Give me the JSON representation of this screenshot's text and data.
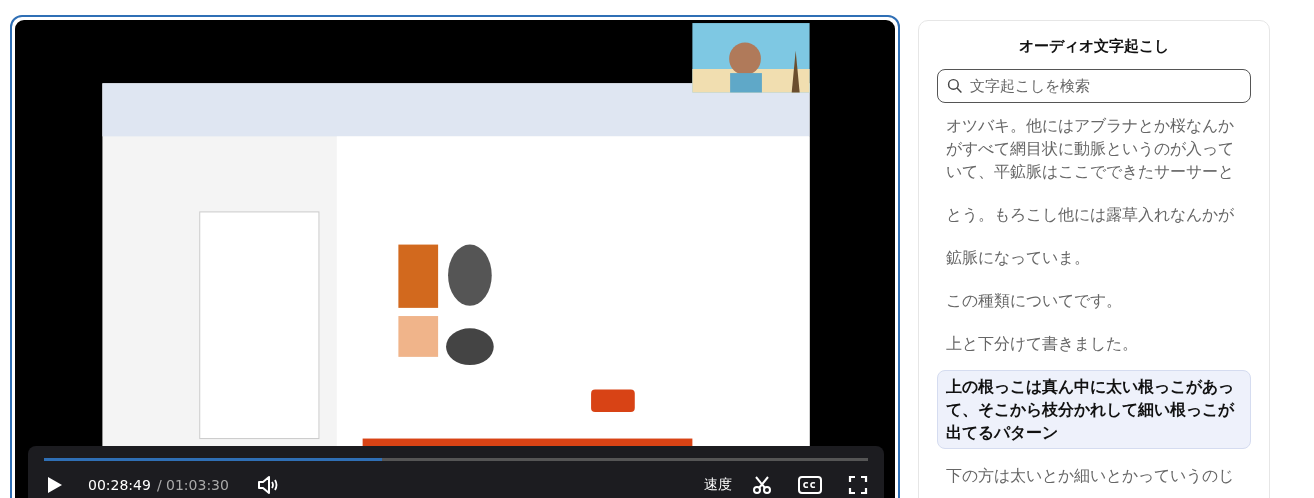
{
  "player": {
    "progress": {
      "level": 0.41
    },
    "time_current": "00:28:49",
    "time_total": "/ 01:03:30",
    "speed_label": "速度"
  },
  "transcript": {
    "title": "オーディオ文字起こし",
    "search": {
      "placeholder": "文字起こしを検索"
    },
    "items": [
      {
        "text": "オツバキ。他にはアブラナとか桜なんかがすべて網目状に動脈というのが入っていて、平鉱脈はここでできたサーサーと",
        "selected": false
      },
      {
        "text": "とう。もろこし他には露草入れなんかが",
        "selected": false
      },
      {
        "text": "鉱脈になっていま。",
        "selected": false
      },
      {
        "text": "この種類についてです。",
        "selected": false
      },
      {
        "text": "上と下分けて書きました。",
        "selected": false
      },
      {
        "text": "上の根っこは真ん中に太い根っこがあって、そこから枝分かれして細い根っこが出てるパターン",
        "selected": true
      },
      {
        "text": "下の方は太いとか細いとかっていうのじ",
        "selected": false
      }
    ]
  }
}
